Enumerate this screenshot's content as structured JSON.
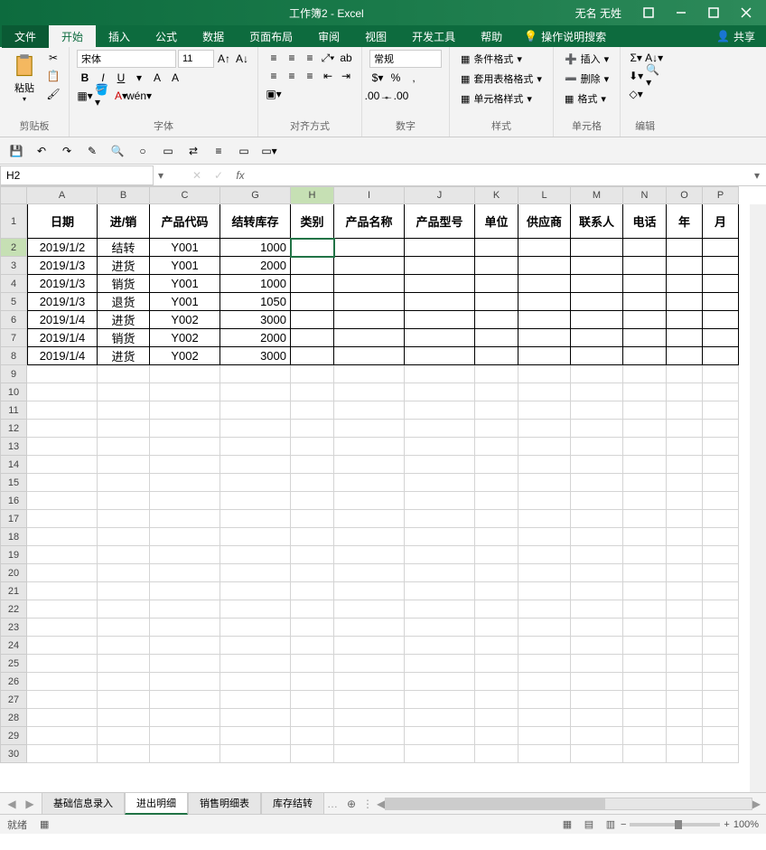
{
  "title_center": "工作簿2 - Excel",
  "title_user": "无名 无姓",
  "ribbon_tabs": {
    "file": "文件",
    "home": "开始",
    "insert": "插入",
    "formulas": "公式",
    "data": "数据",
    "page_layout": "页面布局",
    "review": "审阅",
    "view": "视图",
    "developer": "开发工具",
    "help": "帮助",
    "tell_me": "操作说明搜索",
    "share": "共享"
  },
  "ribbon": {
    "clipboard": {
      "label": "剪贴板",
      "paste": "粘贴"
    },
    "font": {
      "label": "字体",
      "name": "宋体",
      "size": "11"
    },
    "alignment": {
      "label": "对齐方式"
    },
    "number": {
      "label": "数字",
      "format": "常规"
    },
    "styles": {
      "label": "样式",
      "conditional": "条件格式",
      "table": "套用表格格式",
      "cell": "单元格样式"
    },
    "cells": {
      "label": "单元格",
      "insert": "插入",
      "delete": "删除",
      "format": "格式"
    },
    "editing": {
      "label": "编辑"
    }
  },
  "name_box": "H2",
  "formula_value": "",
  "columns": [
    "A",
    "B",
    "C",
    "G",
    "H",
    "I",
    "J",
    "K",
    "L",
    "M",
    "N",
    "O",
    "P"
  ],
  "active_col": "H",
  "headers": [
    "日期",
    "进/销",
    "产品代码",
    "结转库存",
    "类别",
    "产品名称",
    "产品型号",
    "单位",
    "供应商",
    "联系人",
    "电话",
    "年",
    "月"
  ],
  "rows": [
    [
      "2019/1/2",
      "结转",
      "Y001",
      "1000",
      "",
      "",
      "",
      "",
      "",
      "",
      "",
      "",
      ""
    ],
    [
      "2019/1/3",
      "进货",
      "Y001",
      "2000",
      "",
      "",
      "",
      "",
      "",
      "",
      "",
      "",
      ""
    ],
    [
      "2019/1/3",
      "销货",
      "Y001",
      "1000",
      "",
      "",
      "",
      "",
      "",
      "",
      "",
      "",
      ""
    ],
    [
      "2019/1/3",
      "退货",
      "Y001",
      "1050",
      "",
      "",
      "",
      "",
      "",
      "",
      "",
      "",
      ""
    ],
    [
      "2019/1/4",
      "进货",
      "Y002",
      "3000",
      "",
      "",
      "",
      "",
      "",
      "",
      "",
      "",
      ""
    ],
    [
      "2019/1/4",
      "销货",
      "Y002",
      "2000",
      "",
      "",
      "",
      "",
      "",
      "",
      "",
      "",
      ""
    ],
    [
      "2019/1/4",
      "进货",
      "Y002",
      "3000",
      "",
      "",
      "",
      "",
      "",
      "",
      "",
      "",
      ""
    ]
  ],
  "row_numbers": [
    1,
    2,
    3,
    4,
    5,
    6,
    7,
    8,
    9,
    10,
    11,
    12,
    13,
    14,
    15,
    16,
    17,
    18,
    19,
    20,
    21,
    22,
    23,
    24,
    25,
    26,
    27,
    28,
    29,
    30
  ],
  "active_row": 2,
  "sheet_tabs": [
    "基础信息录入",
    "进出明细",
    "销售明细表",
    "库存结转"
  ],
  "active_sheet": 1,
  "status": {
    "ready": "就绪",
    "zoom": "100%"
  }
}
